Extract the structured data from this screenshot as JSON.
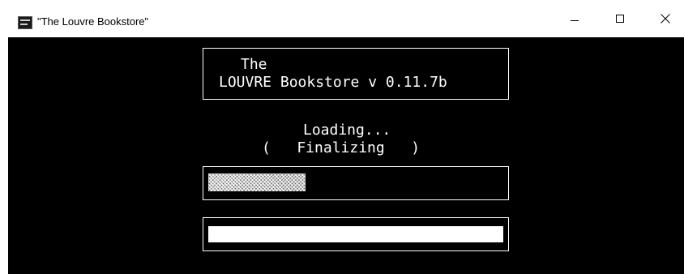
{
  "window": {
    "title": "\"The Louvre Bookstore\"",
    "icon": "app-icon",
    "controls": {
      "minimize": "minimize-icon",
      "maximize": "maximize-icon",
      "close": "close-icon"
    }
  },
  "console": {
    "background": "#000000",
    "foreground": "#ffffff",
    "header": {
      "line1": "The",
      "line2": "LOUVRE Bookstore v 0.11.7b"
    },
    "loading": {
      "label": "Loading...",
      "status": "(   Finalizing   )"
    },
    "progress": {
      "fraction": 0.33
    },
    "input": {
      "value": ""
    }
  }
}
